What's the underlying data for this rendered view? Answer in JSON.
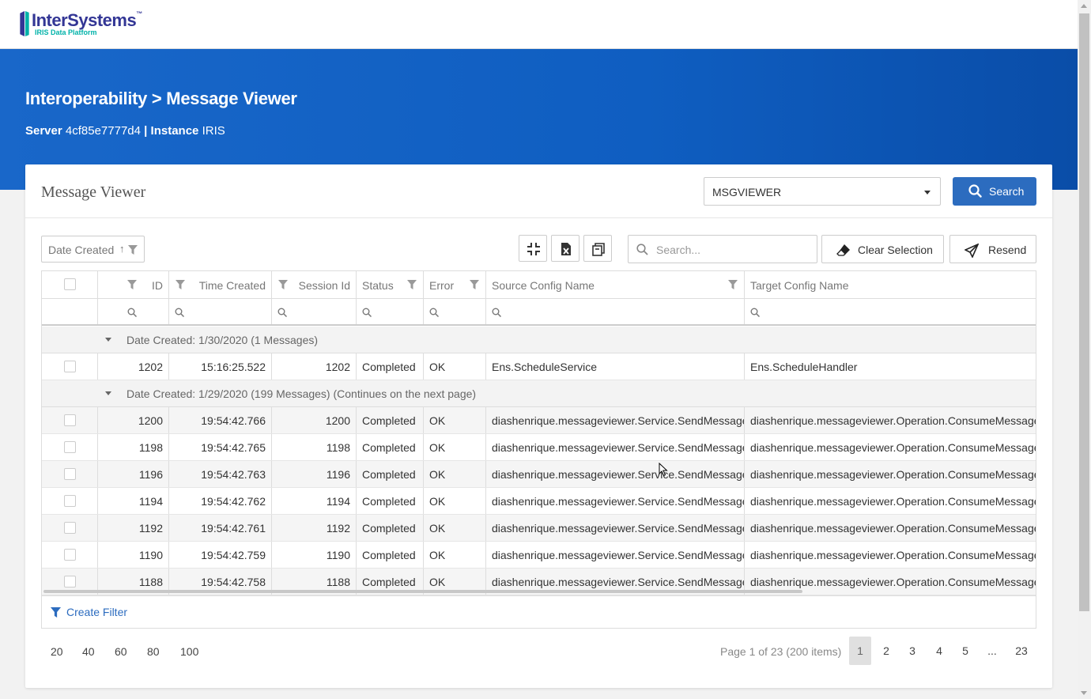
{
  "brand": {
    "name": "InterSystems",
    "tm": "™",
    "subtitle": "IRIS Data Platform"
  },
  "banner": {
    "title": "Interoperability > Message Viewer",
    "server_label": "Server",
    "server_value": "4cf85e7777d4",
    "separator": "|",
    "instance_label": "Instance",
    "instance_value": "IRIS"
  },
  "card": {
    "title": "Message Viewer",
    "saved_search": "MSGVIEWER",
    "search_button": "Search"
  },
  "toolbar": {
    "sort_chip": "Date Created",
    "sort_arrow": "↑",
    "search_placeholder": "Search...",
    "clear_selection": "Clear Selection",
    "resend": "Resend"
  },
  "columns": [
    "ID",
    "Time Created",
    "Session Id",
    "Status",
    "Error",
    "Source Config Name",
    "Target Config Name"
  ],
  "groups": [
    {
      "label": "Date Created: 1/30/2020 (1 Messages)",
      "rows": [
        {
          "id": "1202",
          "time": "15:16:25.522",
          "session": "1202",
          "status": "Completed",
          "error": "OK",
          "source": "Ens.ScheduleService",
          "target": "Ens.ScheduleHandler"
        }
      ]
    },
    {
      "label": "Date Created: 1/29/2020 (199 Messages) (Continues on the next page)",
      "rows": [
        {
          "id": "1200",
          "time": "19:54:42.766",
          "session": "1200",
          "status": "Completed",
          "error": "OK",
          "source": "diashenrique.messageviewer.Service.SendMessage",
          "target": "diashenrique.messageviewer.Operation.ConsumeMessageClass"
        },
        {
          "id": "1198",
          "time": "19:54:42.765",
          "session": "1198",
          "status": "Completed",
          "error": "OK",
          "source": "diashenrique.messageviewer.Service.SendMessage",
          "target": "diashenrique.messageviewer.Operation.ConsumeMessageClass"
        },
        {
          "id": "1196",
          "time": "19:54:42.763",
          "session": "1196",
          "status": "Completed",
          "error": "OK",
          "source": "diashenrique.messageviewer.Service.SendMessage",
          "target": "diashenrique.messageviewer.Operation.ConsumeMessageClass"
        },
        {
          "id": "1194",
          "time": "19:54:42.762",
          "session": "1194",
          "status": "Completed",
          "error": "OK",
          "source": "diashenrique.messageviewer.Service.SendMessage",
          "target": "diashenrique.messageviewer.Operation.ConsumeMessageClass"
        },
        {
          "id": "1192",
          "time": "19:54:42.761",
          "session": "1192",
          "status": "Completed",
          "error": "OK",
          "source": "diashenrique.messageviewer.Service.SendMessage",
          "target": "diashenrique.messageviewer.Operation.ConsumeMessageClass"
        },
        {
          "id": "1190",
          "time": "19:54:42.759",
          "session": "1190",
          "status": "Completed",
          "error": "OK",
          "source": "diashenrique.messageviewer.Service.SendMessage",
          "target": "diashenrique.messageviewer.Operation.ConsumeMessageClass"
        },
        {
          "id": "1188",
          "time": "19:54:42.758",
          "session": "1188",
          "status": "Completed",
          "error": "OK",
          "source": "diashenrique.messageviewer.Service.SendMessage",
          "target": "diashenrique.messageviewer.Operation.ConsumeMessageClass"
        }
      ]
    }
  ],
  "create_filter": "Create Filter",
  "pager": {
    "sizes": [
      "20",
      "40",
      "60",
      "80",
      "100"
    ],
    "info": "Page 1 of 23 (200 items)",
    "pages": [
      "1",
      "2",
      "3",
      "4",
      "5",
      "...",
      "23"
    ],
    "current": "1"
  },
  "colors": {
    "brand": "#333695",
    "banner": "#1967c9",
    "primary": "#2c6cbf"
  }
}
